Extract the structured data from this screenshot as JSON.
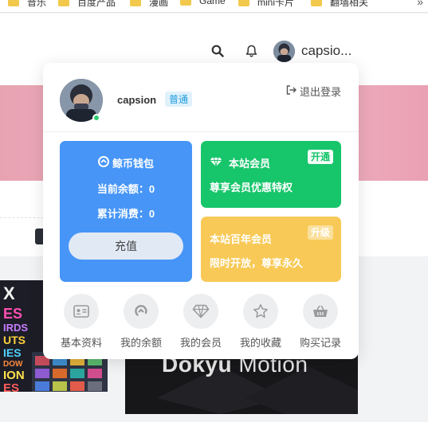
{
  "bookmarks": {
    "items": [
      "音乐",
      "百度产品",
      "漫画",
      "Game",
      "mini卡片",
      "翻墙相关"
    ],
    "overflow": "»"
  },
  "header": {
    "search_icon": "search-icon",
    "bell_icon": "bell-icon",
    "username": "capsio..."
  },
  "banner_card": {
    "title_bold": "Dokyu",
    "title_light": "Motion"
  },
  "panel": {
    "username": "capsion",
    "level": "普通",
    "logout_label": "退出登录",
    "wallet": {
      "title": "鲸币钱包",
      "balance_label": "当前余额：",
      "balance_value": "0",
      "spent_label": "累计消费：",
      "spent_value": "0",
      "recharge_label": "充值"
    },
    "vip": {
      "title": "本站会员",
      "badge": "开通",
      "desc": "尊享会员优惠特权"
    },
    "century": {
      "title": "本站百年会员",
      "badge": "升级",
      "desc": "限时开放，尊享永久"
    },
    "shortcuts": [
      {
        "label": "基本资料",
        "icon": "id-card-icon"
      },
      {
        "label": "我的余额",
        "icon": "balance-icon"
      },
      {
        "label": "我的会员",
        "icon": "diamond-icon"
      },
      {
        "label": "我的收藏",
        "icon": "star-icon"
      },
      {
        "label": "购买记录",
        "icon": "basket-icon"
      }
    ]
  },
  "colors": {
    "wallet_bg": "#4695f7",
    "vip_bg": "#17c56b",
    "century_bg": "#f8c956",
    "online": "#2ecc71"
  }
}
